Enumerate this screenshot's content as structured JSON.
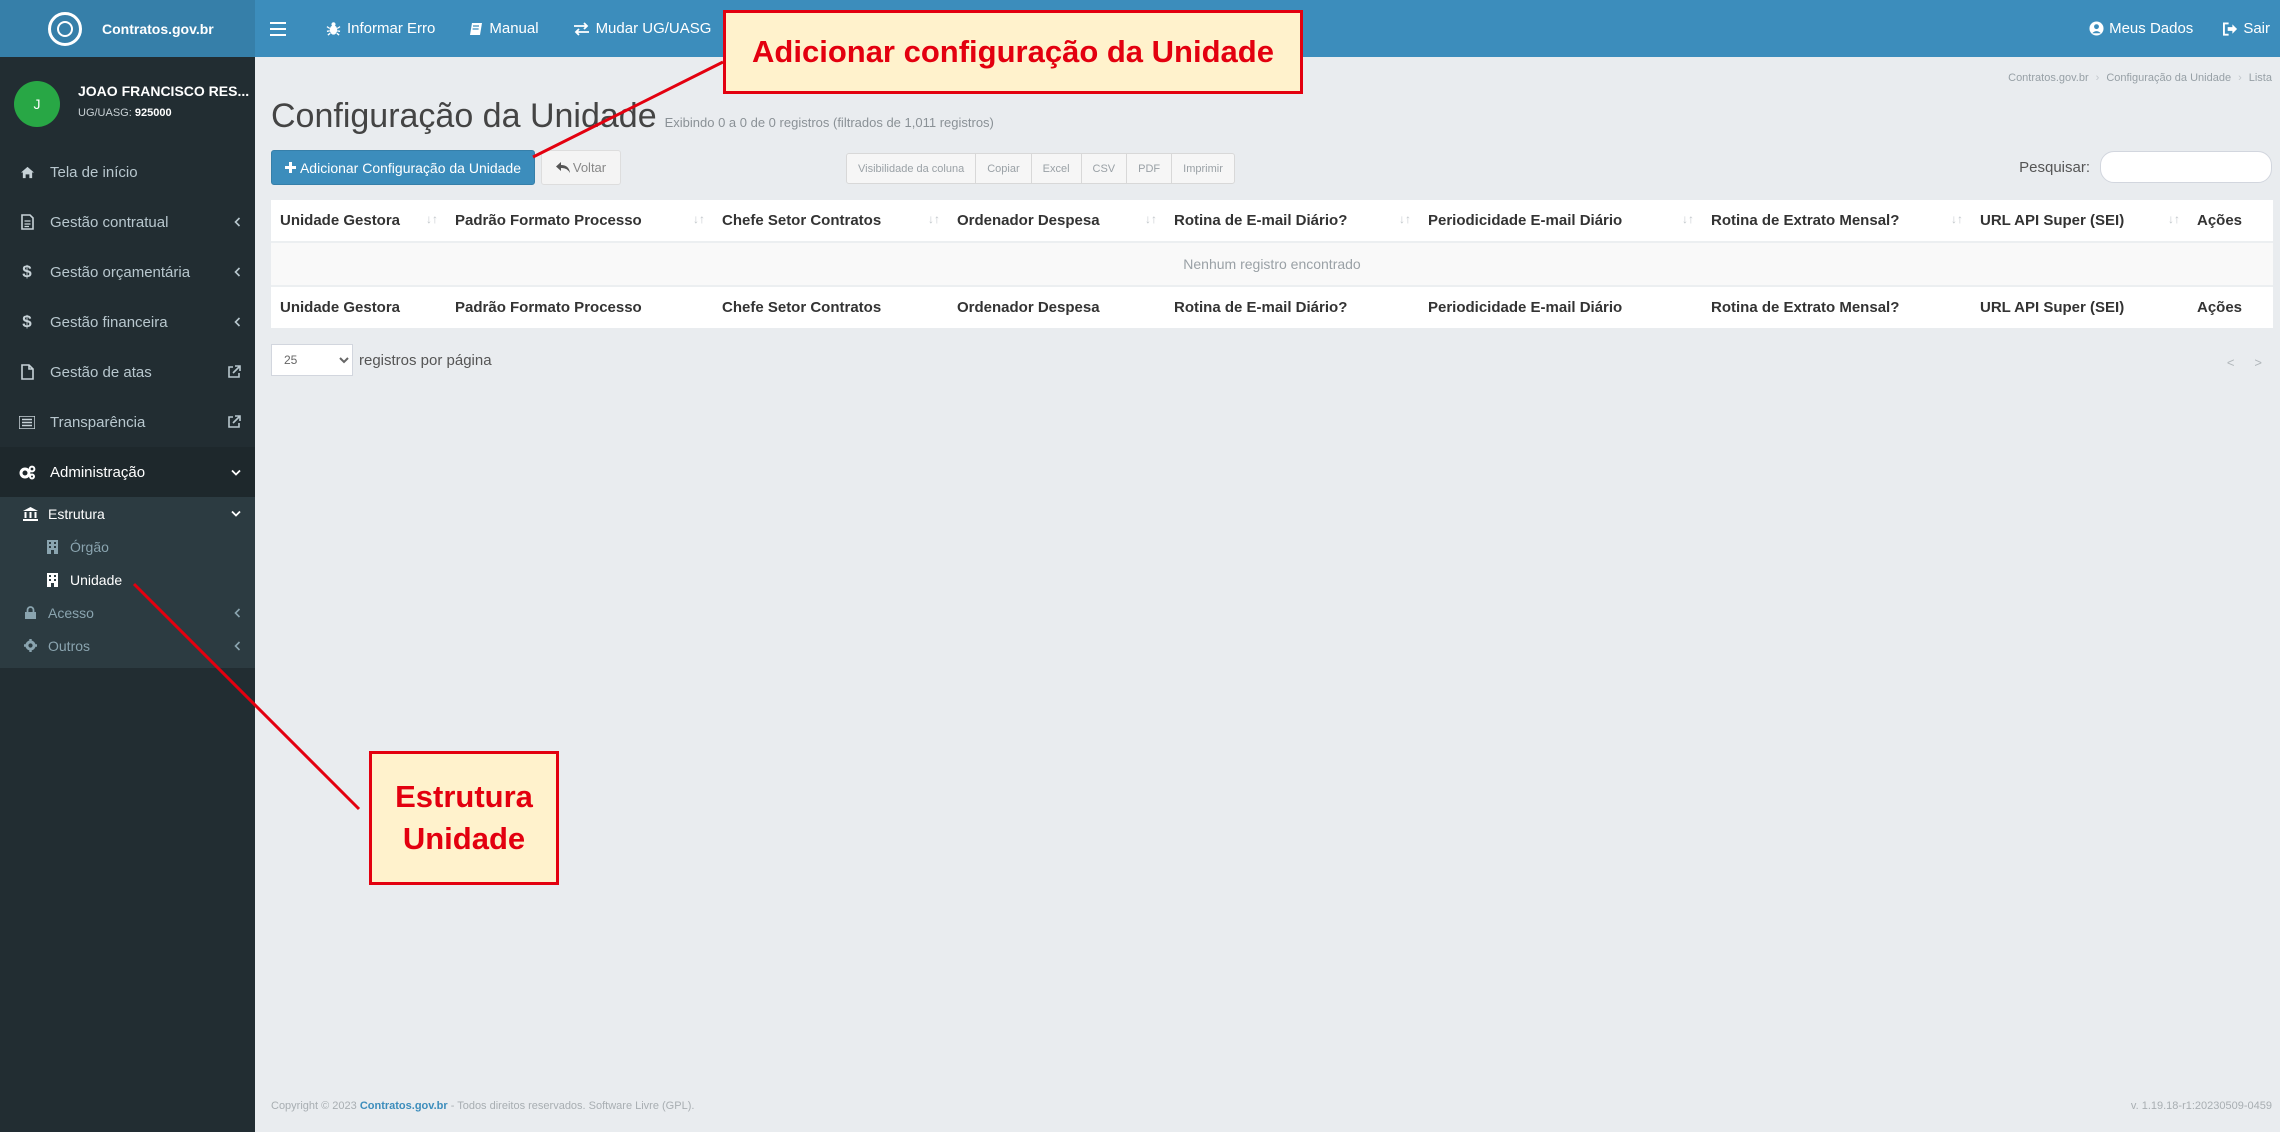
{
  "app": {
    "brand": "Contratos.gov.br",
    "accent_color": "#3c8dbc",
    "sidebar_color": "#222d32"
  },
  "topnav": {
    "report_error": "Informar Erro",
    "manual": "Manual",
    "change_ug": "Mudar UG/UASG",
    "my_data": "Meus Dados",
    "logout": "Sair"
  },
  "user": {
    "initial": "J",
    "name": "JOAO FRANCISCO RES...",
    "ug_label": "UG/UASG:",
    "ug_value": "925000"
  },
  "sidebar": {
    "items": [
      {
        "label": "Tela de início",
        "icon": "home-icon"
      },
      {
        "label": "Gestão contratual",
        "icon": "file-text-icon"
      },
      {
        "label": "Gestão orçamentária",
        "icon": "dollar-icon"
      },
      {
        "label": "Gestão financeira",
        "icon": "dollar-icon"
      },
      {
        "label": "Gestão de atas",
        "icon": "file-icon"
      },
      {
        "label": "Transparência",
        "icon": "list-icon"
      },
      {
        "label": "Administração",
        "icon": "cogs-icon"
      }
    ],
    "sub": {
      "estrutura": "Estrutura",
      "orgao": "Órgão",
      "unidade": "Unidade",
      "acesso": "Acesso",
      "outros": "Outros"
    }
  },
  "breadcrumb": [
    "Contratos.gov.br",
    "Configuração da Unidade",
    "Lista"
  ],
  "page": {
    "title": "Configuração da Unidade",
    "subtitle": "Exibindo 0 a 0 de 0 registros (filtrados de 1,011 registros)"
  },
  "actions": {
    "add": "Adicionar Configuração da Unidade",
    "back": "Voltar"
  },
  "export_buttons": [
    "Visibilidade da coluna",
    "Copiar",
    "Excel",
    "CSV",
    "PDF",
    "Imprimir"
  ],
  "search": {
    "label": "Pesquisar:",
    "placeholder": ""
  },
  "table": {
    "columns": [
      "Unidade Gestora",
      "Padrão Formato Processo",
      "Chefe Setor Contratos",
      "Ordenador Despesa",
      "Rotina de E-mail Diário?",
      "Periodicidade E-mail Diário",
      "Rotina de Extrato Mensal?",
      "URL API Super (SEI)",
      "Ações"
    ],
    "empty_message": "Nenhum registro encontrado"
  },
  "pagination": {
    "page_size": "25",
    "page_size_label": "registros por página",
    "prev": "<",
    "next": ">"
  },
  "footer": {
    "copyright_prefix": "Copyright © 2023",
    "site": "Contratos.gov.br",
    "copyright_suffix": "- Todos direitos reservados. Software Livre (GPL).",
    "version": "v. 1.19.18-r1:20230509-0459"
  },
  "annotations": {
    "top": "Adicionar configuração da Unidade",
    "left_line1": "Estrutura",
    "left_line2": "Unidade",
    "color": "#e3000f"
  }
}
